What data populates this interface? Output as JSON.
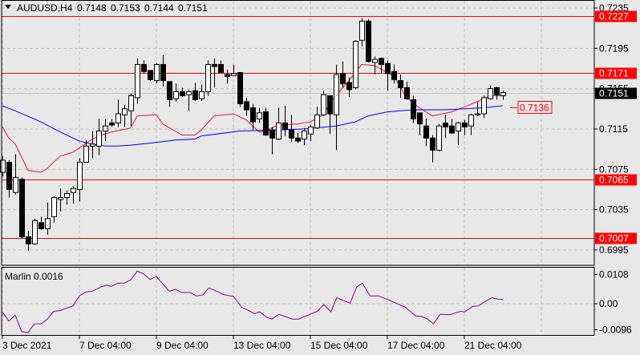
{
  "header": {
    "symbol_label": "AUDUSD,H4",
    "open": "0.7148",
    "high": "0.7153",
    "low": "0.7144",
    "close": "0.7151"
  },
  "indicator": {
    "label": "Marlin 0.0016"
  },
  "colors": {
    "background": "#e8e8e8",
    "grid": "#c0c0c0",
    "level_line": "#ff0000",
    "fast_ma": "#e0143c",
    "slow_ma": "#0000ff",
    "oscillator": "#8b008b",
    "bull_body": "#ffffff",
    "bear_body": "#000000"
  },
  "chart_data": [
    {
      "type": "candlestick",
      "title": "AUDUSD,H4",
      "ylim": [
        0.6985,
        0.7243
      ],
      "price_ticks": [
        "0.7235",
        "0.7195",
        "0.7155",
        "0.7115",
        "0.7075",
        "0.7035",
        "0.6995"
      ],
      "time_labels": [
        {
          "index": 0,
          "label": "3 Dec 2021"
        },
        {
          "index": 12,
          "label": "7 Dec 04:00"
        },
        {
          "index": 24,
          "label": "9 Dec 04:00"
        },
        {
          "index": 36,
          "label": "13 Dec 04:00"
        },
        {
          "index": 48,
          "label": "15 Dec 04:00"
        },
        {
          "index": 60,
          "label": "17 Dec 04:00"
        },
        {
          "index": 72,
          "label": "21 Dec 04:00"
        }
      ],
      "levels": [
        {
          "value": 0.7227,
          "label": "0.7227"
        },
        {
          "value": 0.7171,
          "label": "0.7171"
        },
        {
          "value": 0.7065,
          "label": "0.7065"
        },
        {
          "value": 0.7007,
          "label": "0.7007"
        }
      ],
      "current_price": {
        "value": 0.7151,
        "label": "0.7151"
      },
      "ma_label": {
        "value": 0.7136,
        "label": "0.7136"
      },
      "ohlc": [
        [
          0.7072,
          0.7088,
          0.7068,
          0.7084
        ],
        [
          0.7082,
          0.7084,
          0.7047,
          0.7055
        ],
        [
          0.7052,
          0.709,
          0.705,
          0.7067
        ],
        [
          0.7065,
          0.7067,
          0.7006,
          0.7008
        ],
        [
          0.7008,
          0.7014,
          0.6994,
          0.7001
        ],
        [
          0.7001,
          0.7026,
          0.7,
          0.7024
        ],
        [
          0.7022,
          0.7028,
          0.7015,
          0.7016
        ],
        [
          0.7016,
          0.7042,
          0.701,
          0.7026
        ],
        [
          0.7028,
          0.7048,
          0.7022,
          0.7047
        ],
        [
          0.7045,
          0.7056,
          0.7033,
          0.7047
        ],
        [
          0.7047,
          0.7054,
          0.704,
          0.7051
        ],
        [
          0.7052,
          0.7058,
          0.7041,
          0.7056
        ],
        [
          0.7055,
          0.7086,
          0.7043,
          0.7082
        ],
        [
          0.7082,
          0.7104,
          0.7082,
          0.7098
        ],
        [
          0.7098,
          0.7113,
          0.7086,
          0.71
        ],
        [
          0.7098,
          0.7125,
          0.7089,
          0.7113
        ],
        [
          0.7113,
          0.7125,
          0.7103,
          0.7118
        ],
        [
          0.7121,
          0.7125,
          0.7117,
          0.7119
        ],
        [
          0.7121,
          0.7144,
          0.7117,
          0.713
        ],
        [
          0.7129,
          0.7139,
          0.7117,
          0.7135
        ],
        [
          0.7133,
          0.715,
          0.7118,
          0.7148
        ],
        [
          0.7146,
          0.7185,
          0.714,
          0.7179
        ],
        [
          0.7179,
          0.7183,
          0.717,
          0.7172
        ],
        [
          0.7173,
          0.7173,
          0.7163,
          0.7164
        ],
        [
          0.7163,
          0.718,
          0.716,
          0.7179
        ],
        [
          0.7179,
          0.7188,
          0.7157,
          0.7163
        ],
        [
          0.7162,
          0.7162,
          0.7137,
          0.7144
        ],
        [
          0.7145,
          0.716,
          0.7142,
          0.7152
        ],
        [
          0.7152,
          0.7156,
          0.7147,
          0.7148
        ],
        [
          0.7149,
          0.7154,
          0.7133,
          0.7152
        ],
        [
          0.7153,
          0.7161,
          0.7143,
          0.7144
        ],
        [
          0.7145,
          0.7159,
          0.7143,
          0.7152
        ],
        [
          0.7152,
          0.7183,
          0.7148,
          0.7179
        ],
        [
          0.7179,
          0.7185,
          0.7156,
          0.7177
        ],
        [
          0.7179,
          0.7183,
          0.7171,
          0.7171
        ],
        [
          0.7169,
          0.7174,
          0.716,
          0.7167
        ],
        [
          0.7168,
          0.7179,
          0.7168,
          0.717
        ],
        [
          0.7171,
          0.7171,
          0.7137,
          0.714
        ],
        [
          0.7142,
          0.7146,
          0.7128,
          0.7134
        ],
        [
          0.7136,
          0.714,
          0.7114,
          0.7122
        ],
        [
          0.7125,
          0.7136,
          0.7121,
          0.7131
        ],
        [
          0.7132,
          0.7136,
          0.7108,
          0.7109
        ],
        [
          0.7114,
          0.7117,
          0.709,
          0.7106
        ],
        [
          0.7105,
          0.7136,
          0.7104,
          0.7121
        ],
        [
          0.7121,
          0.7138,
          0.7108,
          0.7115
        ],
        [
          0.7114,
          0.7129,
          0.7102,
          0.7106
        ],
        [
          0.7106,
          0.7111,
          0.7101,
          0.7103
        ],
        [
          0.7105,
          0.7116,
          0.7099,
          0.7113
        ],
        [
          0.711,
          0.7119,
          0.7103,
          0.7117
        ],
        [
          0.7116,
          0.7137,
          0.7115,
          0.7129
        ],
        [
          0.7129,
          0.7153,
          0.7128,
          0.7149
        ],
        [
          0.7148,
          0.7148,
          0.711,
          0.713
        ],
        [
          0.7129,
          0.7179,
          0.7094,
          0.7169
        ],
        [
          0.717,
          0.7182,
          0.7156,
          0.716
        ],
        [
          0.7161,
          0.7166,
          0.7147,
          0.7154
        ],
        [
          0.7156,
          0.7203,
          0.7154,
          0.7202
        ],
        [
          0.7203,
          0.7225,
          0.7197,
          0.7222
        ],
        [
          0.7222,
          0.7224,
          0.7181,
          0.7182
        ],
        [
          0.7181,
          0.7187,
          0.7169,
          0.7184
        ],
        [
          0.7185,
          0.7186,
          0.717,
          0.7179
        ],
        [
          0.718,
          0.7183,
          0.7153,
          0.717
        ],
        [
          0.7172,
          0.7179,
          0.716,
          0.7164
        ],
        [
          0.7163,
          0.7169,
          0.7146,
          0.7156
        ],
        [
          0.7156,
          0.7162,
          0.7144,
          0.7145
        ],
        [
          0.7144,
          0.7148,
          0.7121,
          0.7125
        ],
        [
          0.7131,
          0.7131,
          0.7109,
          0.712
        ],
        [
          0.7118,
          0.7125,
          0.7098,
          0.7106
        ],
        [
          0.7106,
          0.7109,
          0.7082,
          0.7094
        ],
        [
          0.7094,
          0.712,
          0.7093,
          0.7118
        ],
        [
          0.7121,
          0.7129,
          0.7106,
          0.7117
        ],
        [
          0.7118,
          0.7125,
          0.711,
          0.7111
        ],
        [
          0.7113,
          0.7122,
          0.7099,
          0.7121
        ],
        [
          0.7121,
          0.7124,
          0.7109,
          0.7117
        ],
        [
          0.7118,
          0.713,
          0.7109,
          0.7129
        ],
        [
          0.7129,
          0.7142,
          0.7128,
          0.713
        ],
        [
          0.713,
          0.7148,
          0.7126,
          0.7146
        ],
        [
          0.7145,
          0.7158,
          0.7144,
          0.7155
        ],
        [
          0.7156,
          0.7157,
          0.7144,
          0.7149
        ],
        [
          0.7148,
          0.7153,
          0.7144,
          0.7151
        ]
      ],
      "series": [
        {
          "name": "fast_ma",
          "points": [
            [
              0,
              0.7117
            ],
            [
              1,
              0.7106
            ],
            [
              2,
              0.71
            ],
            [
              4,
              0.7074
            ],
            [
              6,
              0.7072
            ],
            [
              7,
              0.7076
            ],
            [
              9,
              0.7088
            ],
            [
              11,
              0.7092
            ],
            [
              12,
              0.7096
            ],
            [
              13,
              0.7101
            ],
            [
              15,
              0.7108
            ],
            [
              17,
              0.7112
            ],
            [
              20,
              0.7116
            ],
            [
              21,
              0.7128
            ],
            [
              24,
              0.7129
            ],
            [
              25,
              0.712
            ],
            [
              28,
              0.7109
            ],
            [
              30,
              0.7109
            ],
            [
              31,
              0.7114
            ],
            [
              33,
              0.7128
            ],
            [
              36,
              0.713
            ],
            [
              38,
              0.7124
            ],
            [
              40,
              0.7112
            ],
            [
              41,
              0.7113
            ],
            [
              43,
              0.7119
            ],
            [
              46,
              0.712
            ],
            [
              48,
              0.7122
            ],
            [
              50,
              0.7129
            ],
            [
              51,
              0.714
            ],
            [
              52,
              0.7148
            ],
            [
              54,
              0.7163
            ],
            [
              56,
              0.7179
            ],
            [
              58,
              0.7178
            ],
            [
              60,
              0.7171
            ],
            [
              61,
              0.7167
            ],
            [
              62,
              0.7157
            ],
            [
              63,
              0.7146
            ],
            [
              65,
              0.7136
            ],
            [
              67,
              0.7128
            ],
            [
              70,
              0.7132
            ],
            [
              72,
              0.7137
            ],
            [
              74,
              0.7142
            ],
            [
              76,
              0.7148
            ],
            [
              78,
              0.7148
            ]
          ]
        },
        {
          "name": "slow_ma",
          "points": [
            [
              0,
              0.7138
            ],
            [
              2,
              0.7133
            ],
            [
              6,
              0.7122
            ],
            [
              9,
              0.7112
            ],
            [
              12,
              0.7103
            ],
            [
              14,
              0.71
            ],
            [
              16,
              0.7098
            ],
            [
              18,
              0.7098
            ],
            [
              20,
              0.7099
            ],
            [
              23,
              0.7101
            ],
            [
              27,
              0.7104
            ],
            [
              30,
              0.7105
            ],
            [
              31,
              0.7108
            ],
            [
              37,
              0.7113
            ],
            [
              43,
              0.7114
            ],
            [
              47,
              0.7115
            ],
            [
              52,
              0.7118
            ],
            [
              55,
              0.7122
            ],
            [
              57,
              0.7128
            ],
            [
              60,
              0.7132
            ],
            [
              62,
              0.7133
            ],
            [
              64,
              0.7134
            ],
            [
              69,
              0.7134
            ],
            [
              75,
              0.7136
            ],
            [
              78,
              0.7138
            ]
          ]
        }
      ]
    },
    {
      "type": "line",
      "title": "Marlin 0.0016",
      "ylim": [
        -0.012,
        0.013
      ],
      "y_ticks": [
        "0.0108",
        "0.00",
        "-0.0096"
      ],
      "y_tick_values": [
        0.0108,
        0.0,
        -0.0096
      ],
      "series": [
        {
          "name": "Marlin",
          "points": [
            [
              0,
              -0.003
            ],
            [
              1,
              -0.0064
            ],
            [
              2,
              -0.0042
            ],
            [
              3,
              -0.0103
            ],
            [
              4,
              -0.0106
            ],
            [
              5,
              -0.0074
            ],
            [
              6,
              -0.0074
            ],
            [
              7,
              -0.0057
            ],
            [
              8,
              -0.0028
            ],
            [
              9,
              -0.0025
            ],
            [
              11,
              -0.0008
            ],
            [
              12,
              0.0029
            ],
            [
              13,
              0.0043
            ],
            [
              14,
              0.0046
            ],
            [
              15.3,
              0.0061
            ],
            [
              16.2,
              0.0068
            ],
            [
              17,
              0.0064
            ],
            [
              18,
              0.0076
            ],
            [
              19,
              0.0076
            ],
            [
              20,
              0.0088
            ],
            [
              21,
              0.012
            ],
            [
              22,
              0.011
            ],
            [
              23,
              0.0089
            ],
            [
              24,
              0.01
            ],
            [
              26,
              0.0046
            ],
            [
              27,
              0.0053
            ],
            [
              28,
              0.0041
            ],
            [
              29.3,
              0.0041
            ],
            [
              30.2,
              0.0029
            ],
            [
              31.2,
              0.0032
            ],
            [
              32.2,
              0.0058
            ],
            [
              33.4,
              0.0046
            ],
            [
              34.4,
              0.0034
            ],
            [
              36,
              0.0027
            ],
            [
              37.3,
              -0.0013
            ],
            [
              38.2,
              -0.0023
            ],
            [
              39.3,
              -0.0037
            ],
            [
              40.1,
              -0.003
            ],
            [
              41.2,
              -0.005
            ],
            [
              42,
              -0.0057
            ],
            [
              43.1,
              -0.0039
            ],
            [
              44.3,
              -0.0049
            ],
            [
              45.2,
              -0.0057
            ],
            [
              46.2,
              -0.0057
            ],
            [
              47.1,
              -0.0047
            ],
            [
              49.1,
              -0.0028
            ],
            [
              50.1,
              -0.0003
            ],
            [
              51.2,
              -0.003
            ],
            [
              52.1,
              0.0022
            ],
            [
              54.2,
              0.0002
            ],
            [
              55.2,
              0.0061
            ],
            [
              56.1,
              0.0076
            ],
            [
              57.3,
              0.0029
            ],
            [
              58.6,
              0.0029
            ],
            [
              60.2,
              0.0014
            ],
            [
              62.8,
              -0.0013
            ],
            [
              64.4,
              -0.0045
            ],
            [
              65.3,
              -0.0047
            ],
            [
              66.3,
              -0.0057
            ],
            [
              67.2,
              -0.0074
            ],
            [
              68.2,
              -0.0039
            ],
            [
              69.8,
              -0.004
            ],
            [
              71.4,
              -0.0028
            ],
            [
              72,
              -0.003
            ],
            [
              73.3,
              -0.001
            ],
            [
              74.2,
              -0.0008
            ],
            [
              75.5,
              0.0012
            ],
            [
              76.3,
              0.0022
            ],
            [
              77.1,
              0.0017
            ],
            [
              78,
              0.0016
            ]
          ]
        }
      ]
    }
  ]
}
